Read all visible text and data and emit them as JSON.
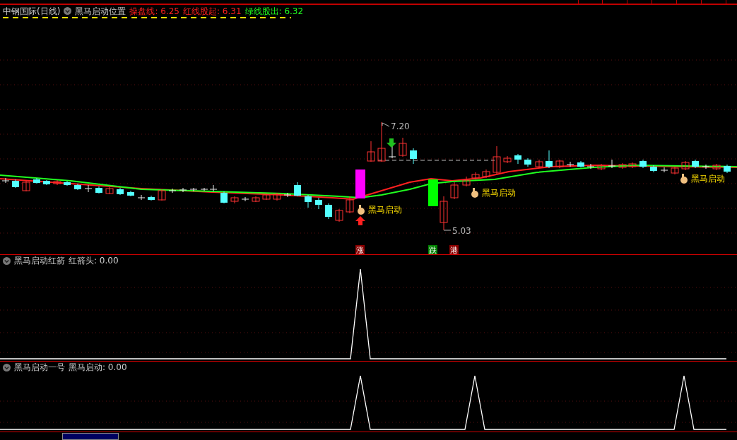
{
  "header": {
    "title": "中钢国际(日线)",
    "indicator": "黑马启动位置",
    "values": [
      {
        "label": "操盘线: 6.25",
        "kind": "rise"
      },
      {
        "label": "红线股起: 6.31",
        "kind": "rise"
      },
      {
        "label": "绿线股出: 6.32",
        "kind": "fall"
      }
    ]
  },
  "main_chart": {
    "high_label": "7.20",
    "low_label": "5.03",
    "signals": [
      {
        "label": "黑马启动"
      },
      {
        "label": "黑马启动"
      },
      {
        "label": "黑马启动"
      }
    ],
    "markers": [
      {
        "text": "涨",
        "color": "#8b0000"
      },
      {
        "text": "跌",
        "color": "#008000"
      },
      {
        "text": "港",
        "color": "#8b0000"
      }
    ]
  },
  "panels": [
    {
      "title": "黑马启动红箭",
      "reading": "红箭头: 0.00"
    },
    {
      "title": "黑马启动一号",
      "reading": "黑马启动: 0.00"
    }
  ]
}
